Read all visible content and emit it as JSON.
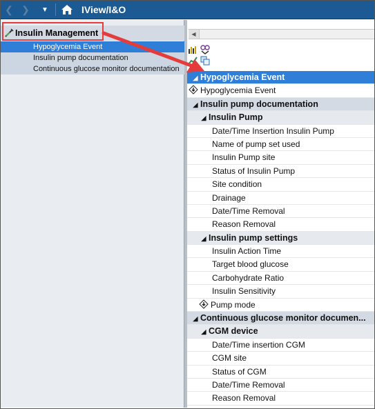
{
  "titlebar": {
    "title": "IView/I&O",
    "back_icon": "chevron-left-icon",
    "forward_icon": "chevron-right-icon",
    "dropdown_icon": "caret-down-icon",
    "home_icon": "home-icon"
  },
  "left_panel": {
    "header_label": "Insulin Management",
    "header_icon": "syringe-icon",
    "items": [
      {
        "label": "Hypoglycemia Event",
        "selected": true
      },
      {
        "label": "Insulin pump documentation",
        "selected": false
      },
      {
        "label": "Continuous glucose monitor documentation",
        "selected": false
      }
    ]
  },
  "right_panel": {
    "toolbar_icons": [
      "chart-icon",
      "flowsheet-icon",
      "graph-icon",
      "copy-icon"
    ],
    "rows": [
      {
        "label": "Hypoglycemia Event",
        "kind": "section-active"
      },
      {
        "label": "Hypoglycemia Event",
        "kind": "powerform-item"
      },
      {
        "label": "Insulin pump documentation",
        "kind": "section"
      },
      {
        "label": "Insulin Pump",
        "kind": "subsection"
      },
      {
        "label": "Date/Time Insertion Insulin Pump",
        "kind": "item"
      },
      {
        "label": "Name of pump set used",
        "kind": "item"
      },
      {
        "label": "Insulin Pump site",
        "kind": "item"
      },
      {
        "label": "Status of Insulin Pump",
        "kind": "item"
      },
      {
        "label": "Site condition",
        "kind": "item"
      },
      {
        "label": "Drainage",
        "kind": "item"
      },
      {
        "label": "Date/Time Removal",
        "kind": "item"
      },
      {
        "label": "Reason Removal",
        "kind": "item"
      },
      {
        "label": "Insulin pump settings",
        "kind": "subsection"
      },
      {
        "label": "Insulin Action Time",
        "kind": "item"
      },
      {
        "label": "Target blood glucose",
        "kind": "item"
      },
      {
        "label": "Carbohydrate Ratio",
        "kind": "item"
      },
      {
        "label": "Insulin Sensitivity",
        "kind": "item"
      },
      {
        "label": "Pump mode",
        "kind": "powerform-sub"
      },
      {
        "label": "Continuous glucose monitor documen...",
        "kind": "section"
      },
      {
        "label": "CGM device",
        "kind": "subsection"
      },
      {
        "label": "Date/Time insertion CGM",
        "kind": "item"
      },
      {
        "label": "CGM site",
        "kind": "item"
      },
      {
        "label": "Status of CGM",
        "kind": "item"
      },
      {
        "label": "Date/Time Removal",
        "kind": "item"
      },
      {
        "label": "Reason Removal",
        "kind": "item"
      }
    ]
  },
  "colors": {
    "titlebar": "#1c5a94",
    "selected": "#2f7fd8",
    "annotation": "#e43b3b"
  }
}
